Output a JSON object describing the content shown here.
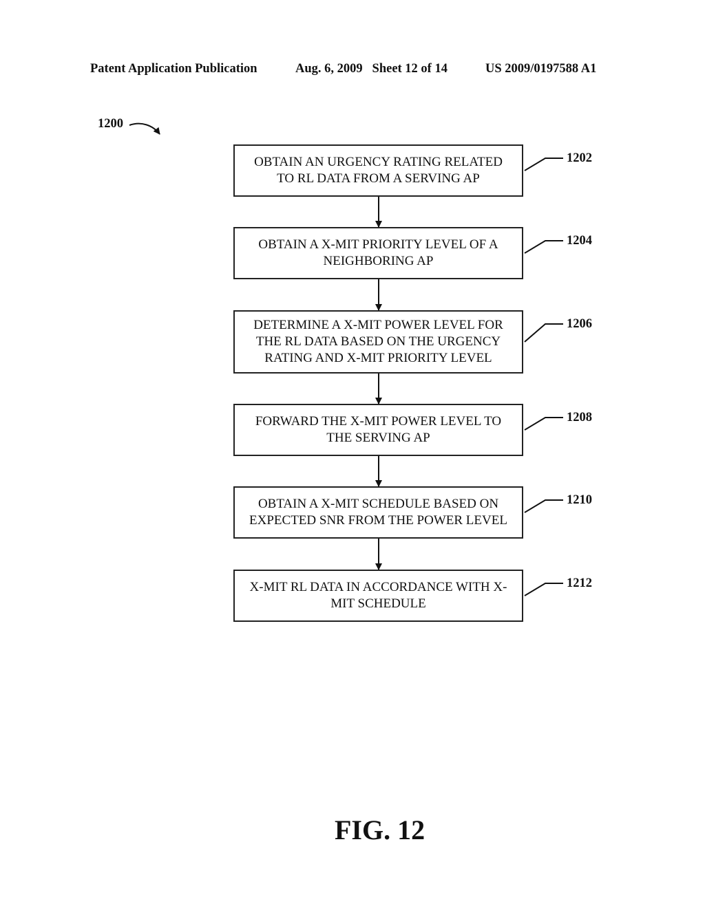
{
  "header": {
    "left": "Patent Application Publication",
    "middle": "Aug. 6, 2009   Sheet 12 of 14",
    "right": "US 2009/0197588 A1"
  },
  "figure_ref": "1200",
  "steps": [
    {
      "ref": "1202",
      "lines": [
        "OBTAIN AN URGENCY RATING RELATED",
        "TO RL DATA FROM A SERVING AP"
      ]
    },
    {
      "ref": "1204",
      "lines": [
        "OBTAIN A X-MIT PRIORITY LEVEL OF A",
        "NEIGHBORING AP"
      ]
    },
    {
      "ref": "1206",
      "lines": [
        "DETERMINE A X-MIT POWER LEVEL FOR",
        "THE RL DATA BASED ON THE URGENCY",
        "RATING AND X-MIT PRIORITY LEVEL"
      ]
    },
    {
      "ref": "1208",
      "lines": [
        "FORWARD THE X-MIT POWER LEVEL TO",
        "THE SERVING AP"
      ]
    },
    {
      "ref": "1210",
      "lines": [
        "OBTAIN A X-MIT SCHEDULE BASED ON",
        "EXPECTED SNR FROM THE POWER LEVEL"
      ]
    },
    {
      "ref": "1212",
      "lines": [
        "X-MIT RL DATA IN ACCORDANCE WITH X-",
        "MIT SCHEDULE"
      ]
    }
  ],
  "figure_label": "FIG. 12"
}
